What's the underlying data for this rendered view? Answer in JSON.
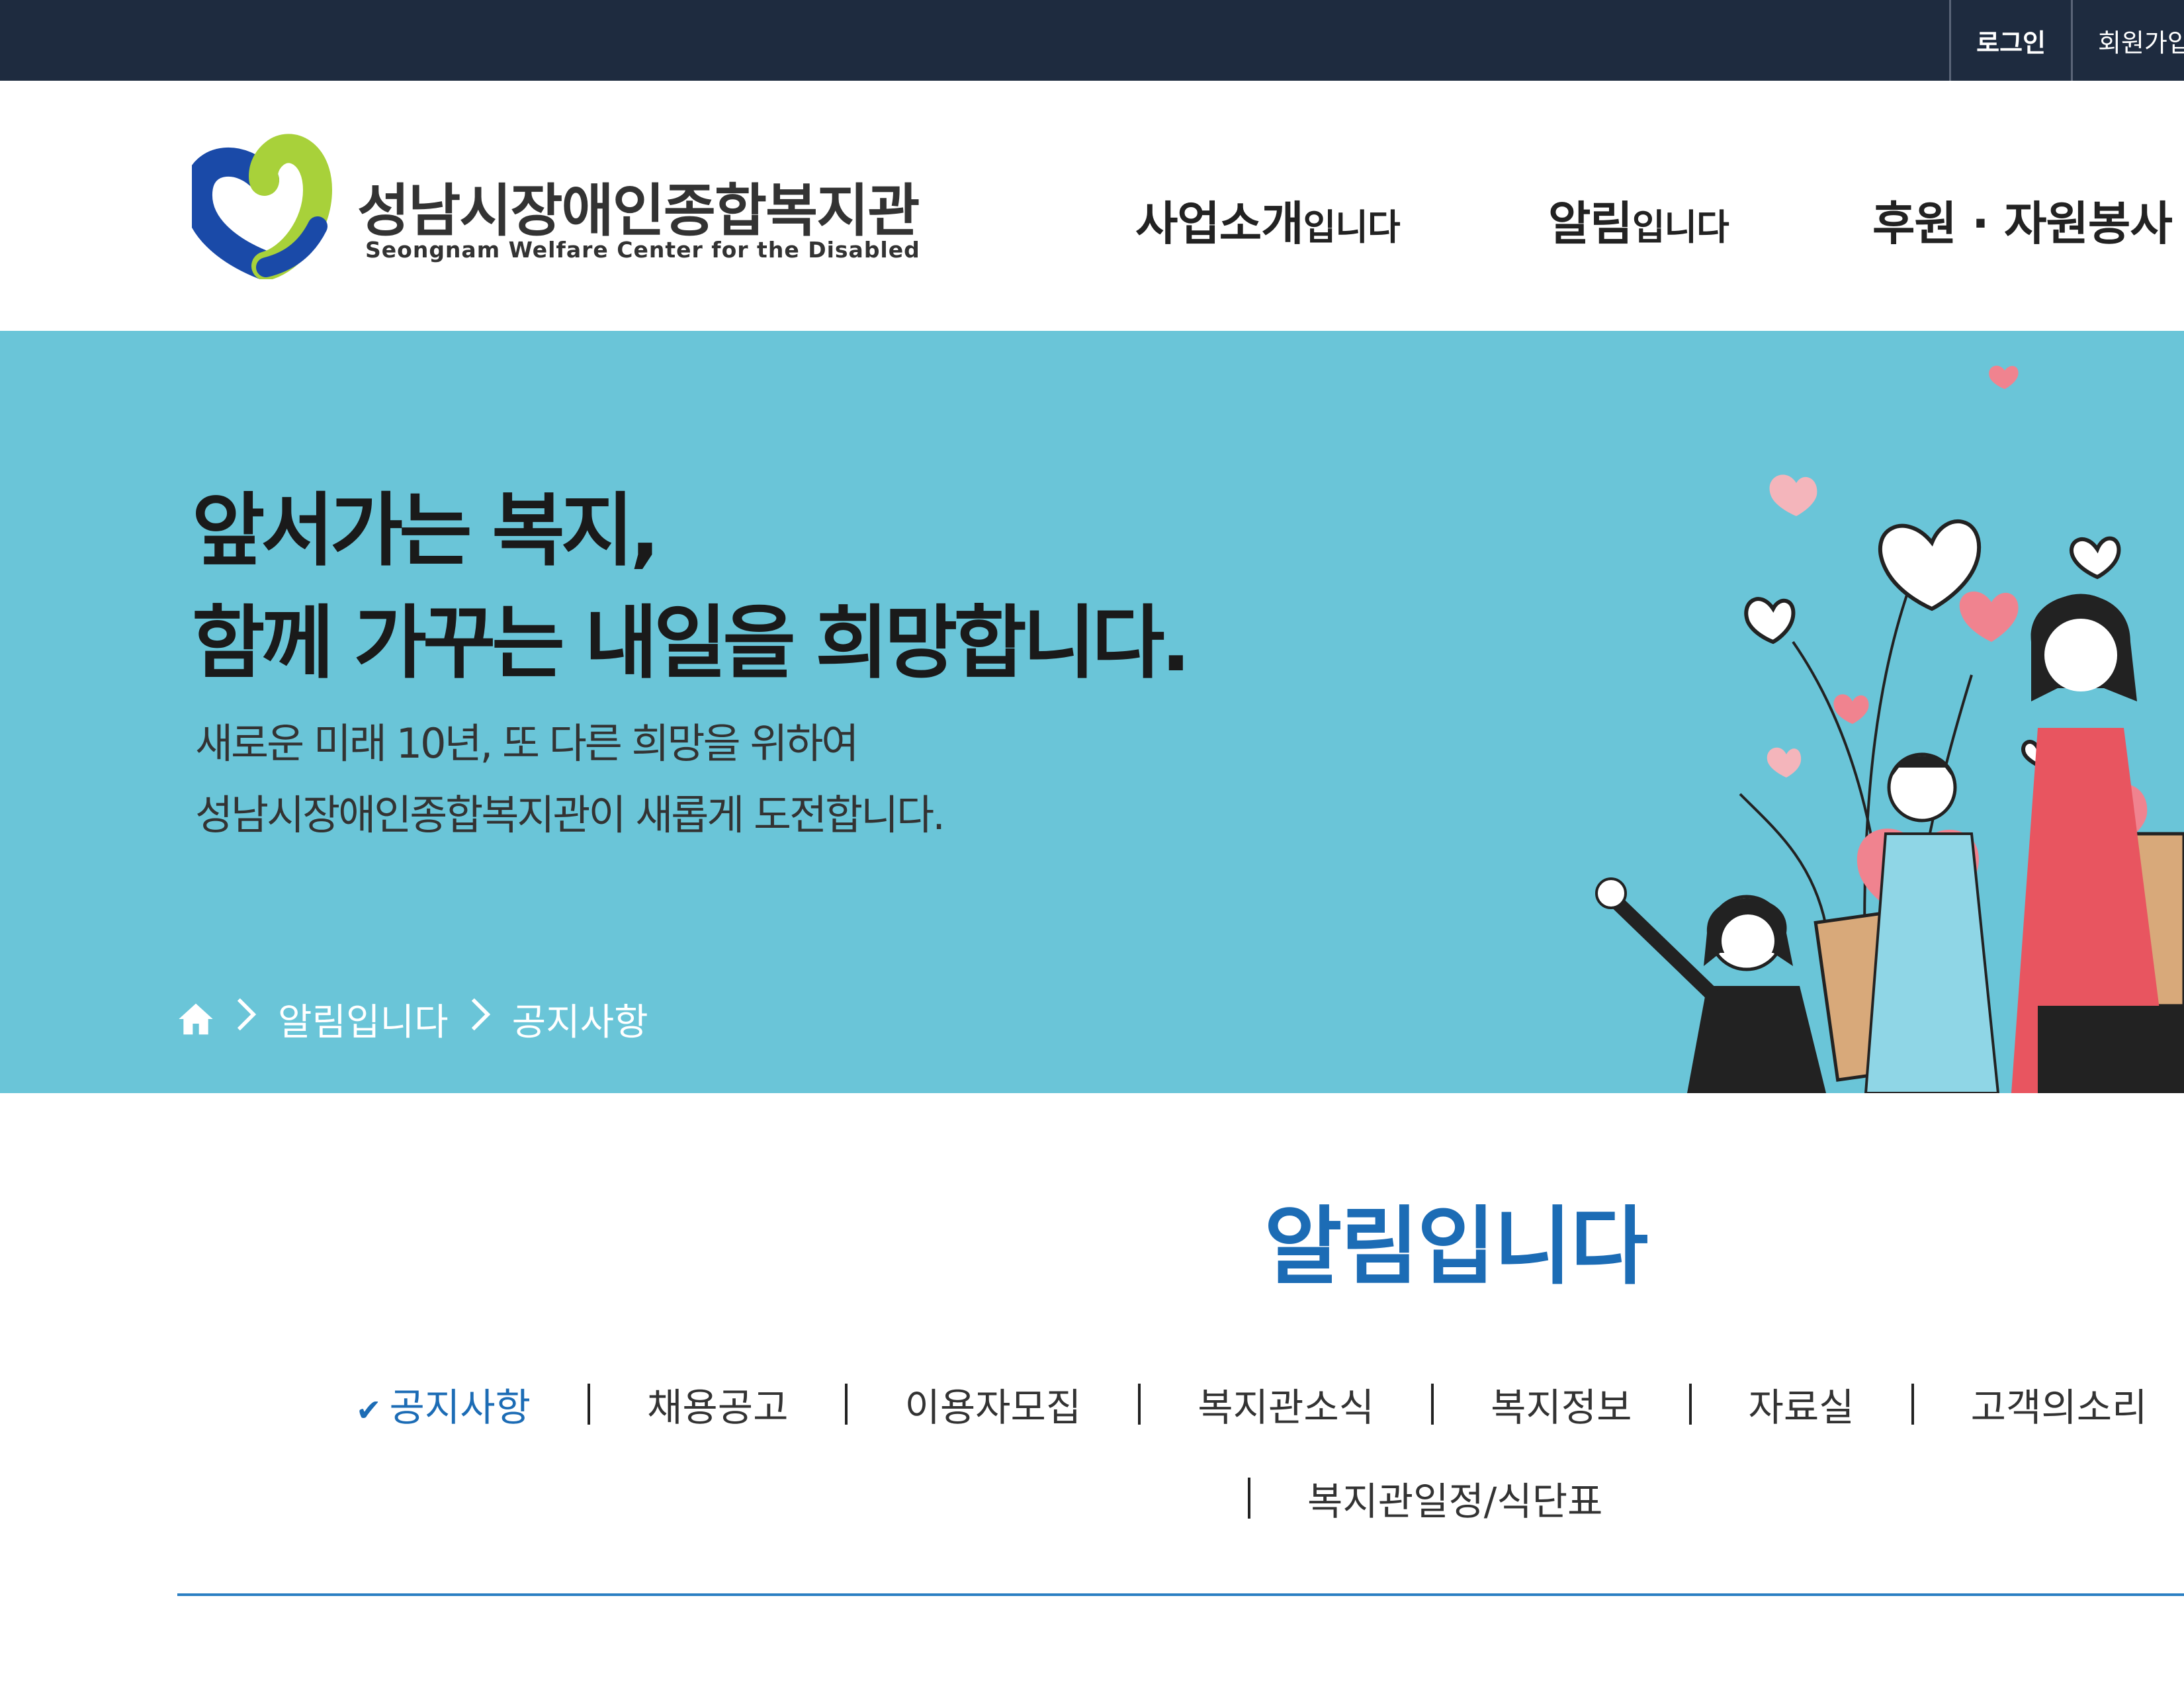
{
  "topbar": {
    "login": "로그인",
    "signup": "회원가입"
  },
  "header": {
    "logo_name": "성남시장애인종합복지관",
    "logo_sub": "Seongnam Welfare Center for the Disabled",
    "gnb": [
      {
        "main": "사업소개",
        "suffix": "입니다"
      },
      {
        "main": "알림",
        "suffix": "입니다"
      },
      {
        "main": "후원 · 자원봉사",
        "suffix": ""
      }
    ]
  },
  "hero": {
    "title_line1": "앞서가는 복지,",
    "title_line2": "함께 가꾸는 내일을 희망합니다.",
    "sub_line1": "새로운 미래 10년, 또 다른 희망을 위하여",
    "sub_line2": "성남시장애인종합복지관이 새롭게 도전합니다.",
    "breadcrumb": [
      "알림입니다",
      "공지사항"
    ]
  },
  "section": {
    "title": "알림입니다",
    "tabs": [
      "공지사항",
      "채용공고",
      "이용자모집",
      "복지관소식",
      "복지정보",
      "자료실",
      "고객의소리",
      "복지관일정/식단표"
    ],
    "active_tab": "공지사항"
  },
  "colors": {
    "topbar": "#1e2b3f",
    "hero_bg": "#6ac5d8",
    "accent": "#1c6cb5",
    "logo_blue": "#1a4aa8",
    "logo_green": "#a8d13a"
  }
}
